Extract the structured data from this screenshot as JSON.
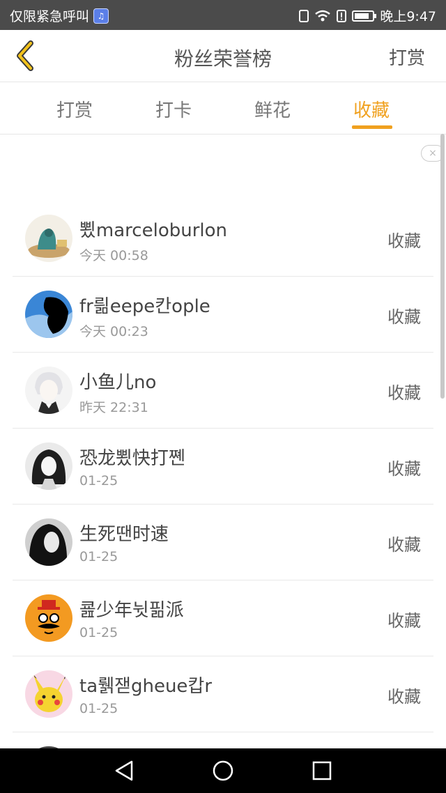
{
  "status_bar": {
    "left_text": "仅限紧急呼叫",
    "time": "晚上9:47"
  },
  "header": {
    "title": "粉丝荣誉榜",
    "action": "打赏"
  },
  "tabs": [
    {
      "label": "打赏",
      "active": false
    },
    {
      "label": "打卡",
      "active": false
    },
    {
      "label": "鲜花",
      "active": false
    },
    {
      "label": "收藏",
      "active": true
    }
  ],
  "accent_color": "#f0a11f",
  "ad": {
    "close_symbol": "×"
  },
  "fans": [
    {
      "name": "뾨marceloburlon",
      "time": "今天 00:58",
      "action": "收藏"
    },
    {
      "name": "fr릚eepe칸ople",
      "time": "今天 00:23",
      "action": "收藏"
    },
    {
      "name": "小鱼儿no",
      "time": "昨天 22:31",
      "action": "收藏"
    },
    {
      "name": "恐龙뾨快打쪤",
      "time": "01-25",
      "action": "收藏"
    },
    {
      "name": "生死땐时速",
      "time": "01-25",
      "action": "收藏"
    },
    {
      "name": "쿒少年뉫핆派",
      "time": "01-25",
      "action": "收藏"
    },
    {
      "name": "ta뤩잳gheue캅r",
      "time": "01-25",
      "action": "收藏"
    }
  ]
}
